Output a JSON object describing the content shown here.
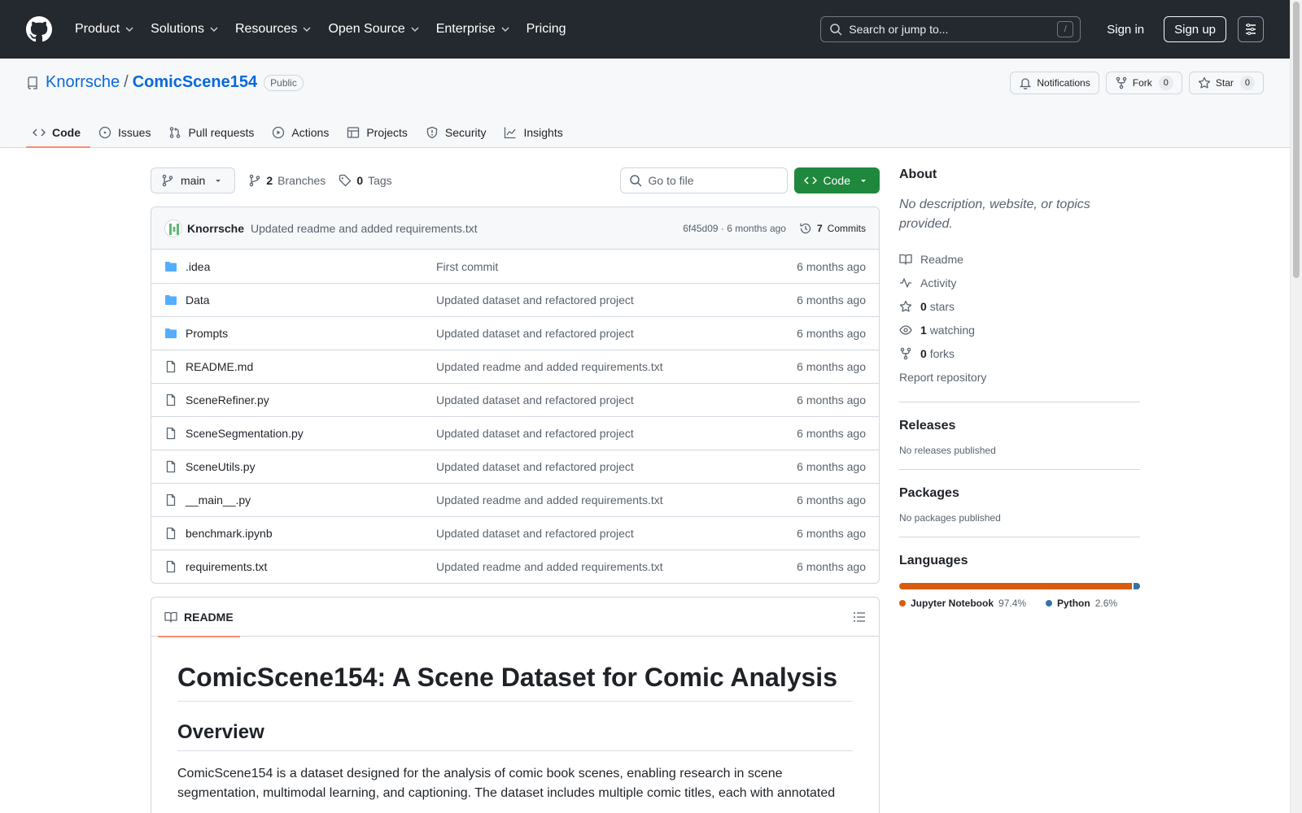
{
  "header": {
    "nav": [
      "Product",
      "Solutions",
      "Resources",
      "Open Source",
      "Enterprise",
      "Pricing"
    ],
    "search_placeholder": "Search or jump to...",
    "search_kbd": "/",
    "signin": "Sign in",
    "signup": "Sign up"
  },
  "repo": {
    "owner": "Knorrsche",
    "sep": "/",
    "name": "ComicScene154",
    "visibility": "Public",
    "notifications": "Notifications",
    "fork_label": "Fork",
    "fork_count": "0",
    "star_label": "Star",
    "star_count": "0"
  },
  "tabs": [
    {
      "label": "Code",
      "icon": "code-icon"
    },
    {
      "label": "Issues",
      "icon": "issue-icon"
    },
    {
      "label": "Pull requests",
      "icon": "pull-request-icon"
    },
    {
      "label": "Actions",
      "icon": "play-icon"
    },
    {
      "label": "Projects",
      "icon": "table-icon"
    },
    {
      "label": "Security",
      "icon": "shield-icon"
    },
    {
      "label": "Insights",
      "icon": "graph-icon"
    }
  ],
  "branch": {
    "name": "main",
    "branches_count": "2",
    "branches_label": "Branches",
    "tags_count": "0",
    "tags_label": "Tags",
    "goto_placeholder": "Go to file",
    "code_button": "Code"
  },
  "commit": {
    "author": "Knorrsche",
    "message": "Updated readme and added requirements.txt",
    "meta": "6f45d09 · 6 months ago",
    "commits_count": "7",
    "commits_label": "Commits"
  },
  "files": [
    {
      "name": ".idea",
      "type": "folder",
      "message": "First commit",
      "age": "6 months ago"
    },
    {
      "name": "Data",
      "type": "folder",
      "message": "Updated dataset and refactored project",
      "age": "6 months ago"
    },
    {
      "name": "Prompts",
      "type": "folder",
      "message": "Updated dataset and refactored project",
      "age": "6 months ago"
    },
    {
      "name": "README.md",
      "type": "file",
      "message": "Updated readme and added requirements.txt",
      "age": "6 months ago"
    },
    {
      "name": "SceneRefiner.py",
      "type": "file",
      "message": "Updated dataset and refactored project",
      "age": "6 months ago"
    },
    {
      "name": "SceneSegmentation.py",
      "type": "file",
      "message": "Updated dataset and refactored project",
      "age": "6 months ago"
    },
    {
      "name": "SceneUtils.py",
      "type": "file",
      "message": "Updated dataset and refactored project",
      "age": "6 months ago"
    },
    {
      "name": "__main__.py",
      "type": "file",
      "message": "Updated readme and added requirements.txt",
      "age": "6 months ago"
    },
    {
      "name": "benchmark.ipynb",
      "type": "file",
      "message": "Updated dataset and refactored project",
      "age": "6 months ago"
    },
    {
      "name": "requirements.txt",
      "type": "file",
      "message": "Updated readme and added requirements.txt",
      "age": "6 months ago"
    }
  ],
  "readme": {
    "tab": "README",
    "h1": "ComicScene154: A Scene Dataset for Comic Analysis",
    "h2": "Overview",
    "p": "ComicScene154 is a dataset designed for the analysis of comic book scenes, enabling research in scene segmentation, multimodal learning, and captioning. The dataset includes multiple comic titles, each with annotated"
  },
  "about": {
    "title": "About",
    "description": "No description, website, or topics provided.",
    "links": [
      {
        "icon": "book-icon",
        "bold": "",
        "label": "Readme"
      },
      {
        "icon": "pulse-icon",
        "bold": "",
        "label": "Activity"
      },
      {
        "icon": "star-icon",
        "bold": "0",
        "label": "stars"
      },
      {
        "icon": "eye-icon",
        "bold": "1",
        "label": "watching"
      },
      {
        "icon": "fork-icon",
        "bold": "0",
        "label": "forks"
      }
    ],
    "report": "Report repository"
  },
  "releases": {
    "title": "Releases",
    "text": "No releases published"
  },
  "packages": {
    "title": "Packages",
    "text": "No packages published"
  },
  "languages": {
    "title": "Languages",
    "items": [
      {
        "name": "Jupyter Notebook",
        "percent": "97.4%",
        "value": 97.4,
        "color": "#DA5B0B"
      },
      {
        "name": "Python",
        "percent": "2.6%",
        "value": 2.6,
        "color": "#3572A5"
      }
    ]
  }
}
